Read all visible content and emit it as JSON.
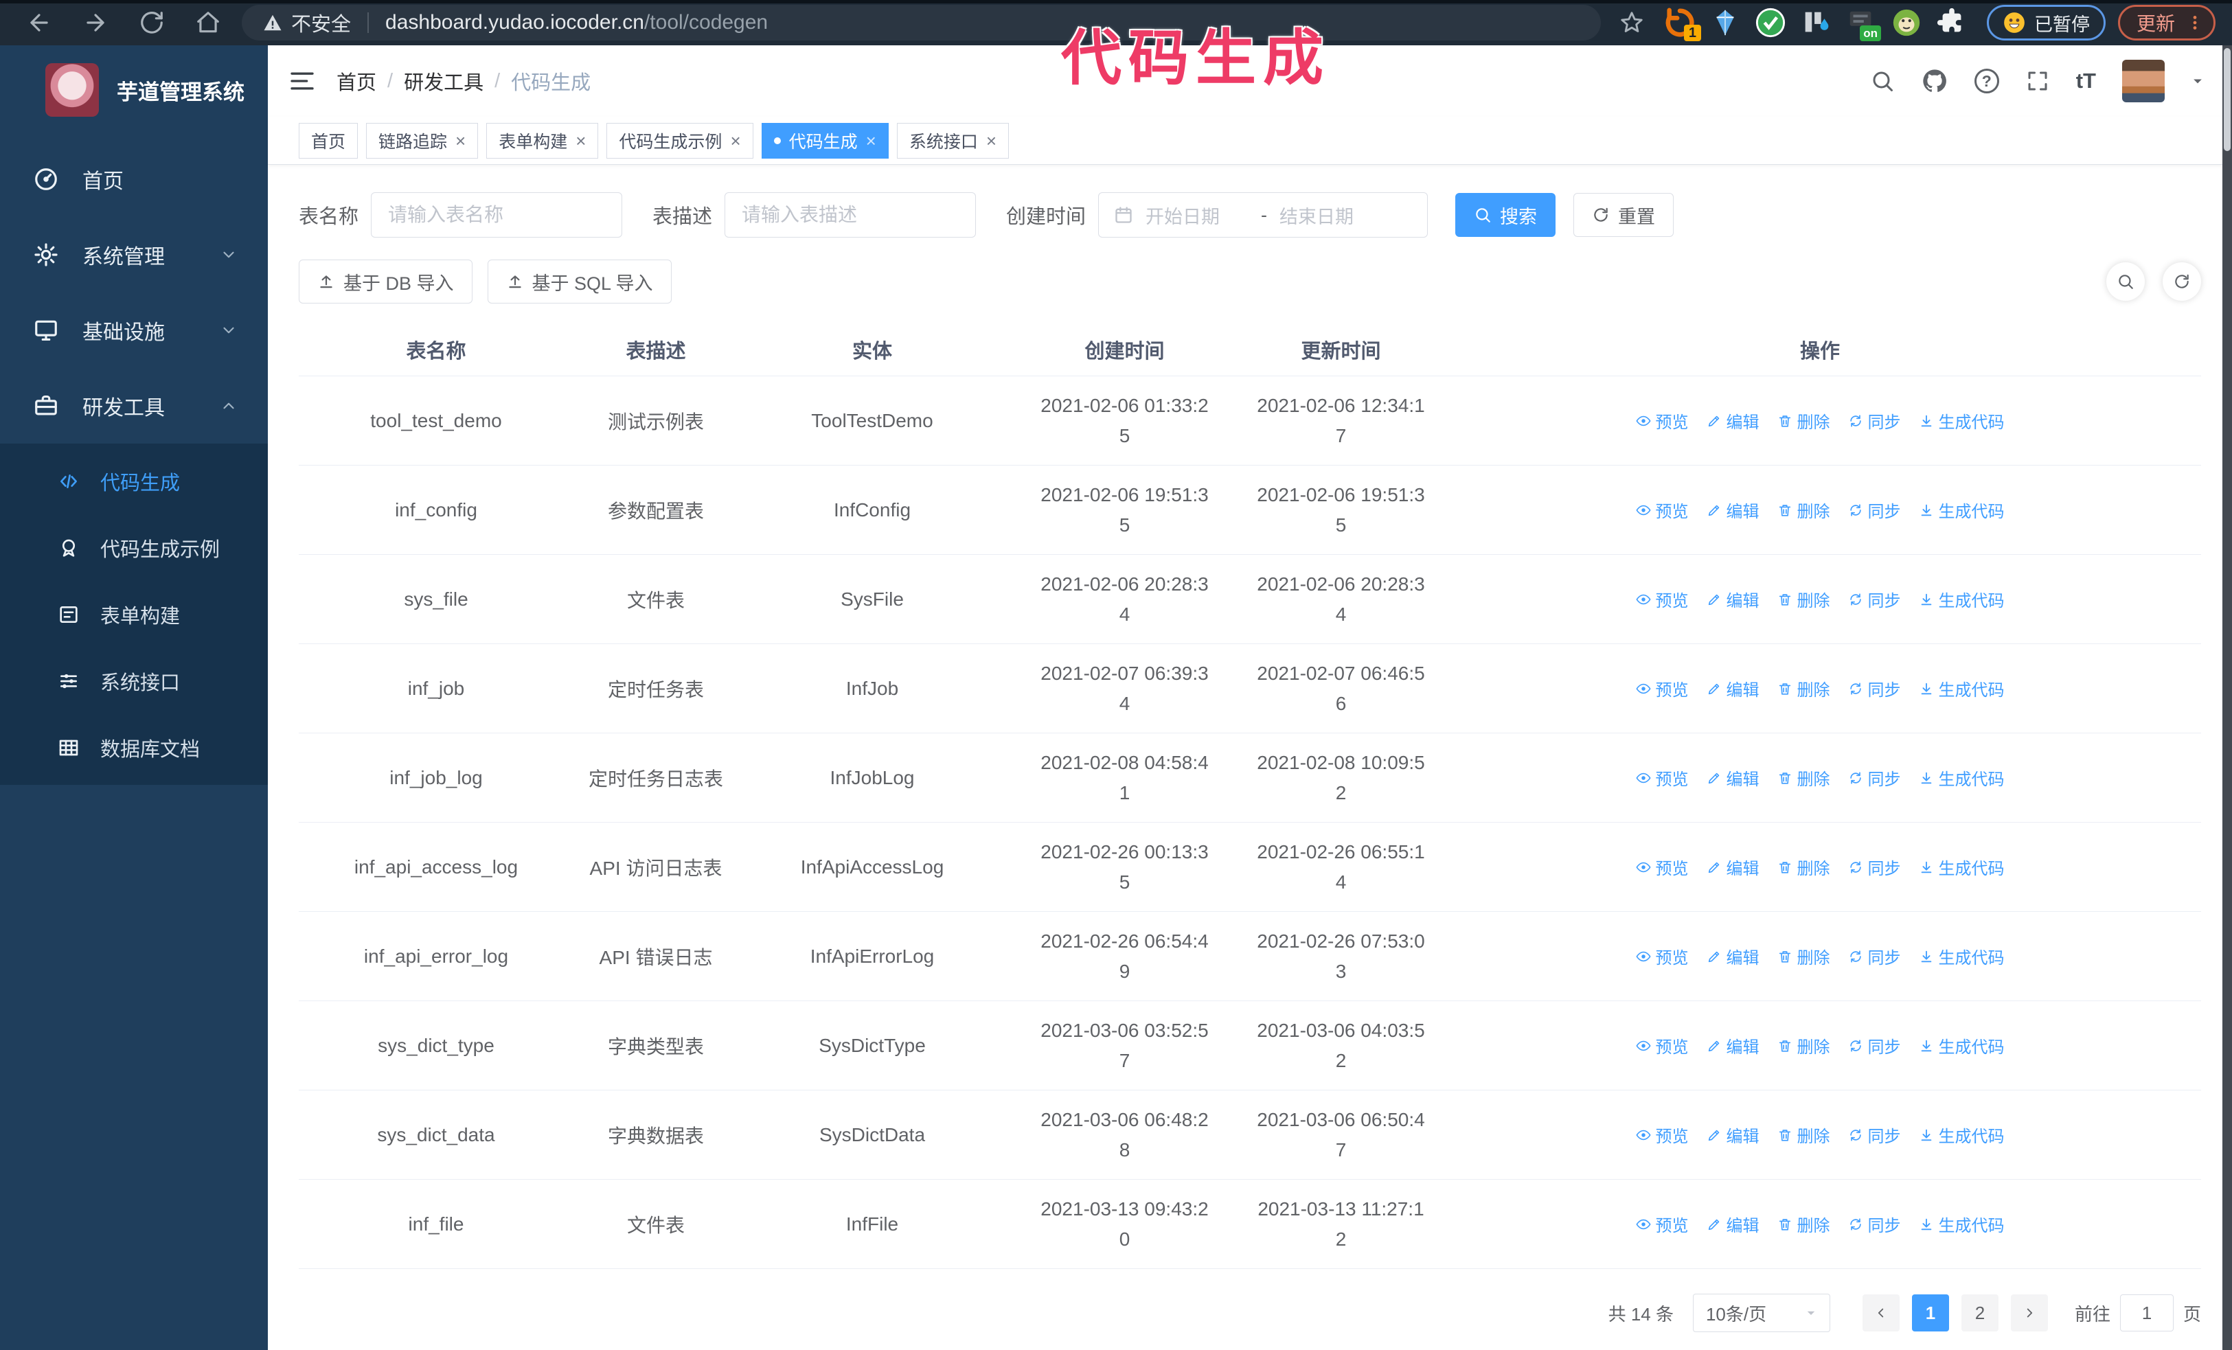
{
  "colors": {
    "accent": "#409eff",
    "annotation": "#ee3b66",
    "sidebar_bg": "#1f3e5c",
    "submenu_bg": "#16324c"
  },
  "overlay": {
    "title": "代码生成"
  },
  "browser": {
    "not_secure_label": "不安全",
    "url_host": "dashboard.yudao.iocoder.cn",
    "url_path": "/tool/codegen",
    "ext_badge": "1",
    "ext_on": "on",
    "paused_label": "已暂停",
    "update_label": "更新"
  },
  "sidebar": {
    "app_title": "芋道管理系统",
    "items": [
      {
        "id": "home",
        "label": "首页",
        "icon": "gauge-icon",
        "chevron": ""
      },
      {
        "id": "system",
        "label": "系统管理",
        "icon": "gear-icon",
        "chevron": "chevron-down-icon"
      },
      {
        "id": "infra",
        "label": "基础设施",
        "icon": "monitor-icon",
        "chevron": "chevron-down-icon"
      },
      {
        "id": "devtools",
        "label": "研发工具",
        "icon": "toolbox-icon",
        "chevron": "chevron-up-icon"
      }
    ],
    "subitems": [
      {
        "id": "codegen",
        "label": "代码生成",
        "icon": "code-icon",
        "active": true
      },
      {
        "id": "codegen-demo",
        "label": "代码生成示例",
        "icon": "medal-icon",
        "active": false
      },
      {
        "id": "form-builder",
        "label": "表单构建",
        "icon": "form-icon",
        "active": false
      },
      {
        "id": "system-api",
        "label": "系统接口",
        "icon": "sliders-icon",
        "active": false
      },
      {
        "id": "db-doc",
        "label": "数据库文档",
        "icon": "dbgrid-icon",
        "active": false
      }
    ]
  },
  "header": {
    "breadcrumb": [
      "首页",
      "研发工具",
      "代码生成"
    ]
  },
  "tabs": [
    {
      "id": "home",
      "label": "首页",
      "closable": false,
      "active": false
    },
    {
      "id": "tracing",
      "label": "链路追踪",
      "closable": true,
      "active": false
    },
    {
      "id": "form-builder",
      "label": "表单构建",
      "closable": true,
      "active": false
    },
    {
      "id": "codegen-demo",
      "label": "代码生成示例",
      "closable": true,
      "active": false
    },
    {
      "id": "codegen",
      "label": "代码生成",
      "closable": true,
      "active": true
    },
    {
      "id": "system-api",
      "label": "系统接口",
      "closable": true,
      "active": false
    }
  ],
  "filters": {
    "name_label": "表名称",
    "name_placeholder": "请输入表名称",
    "desc_label": "表描述",
    "desc_placeholder": "请输入表描述",
    "time_label": "创建时间",
    "start_placeholder": "开始日期",
    "range_separator": "-",
    "end_placeholder": "结束日期",
    "search_label": "搜索",
    "reset_label": "重置"
  },
  "toolbar": {
    "import_db_label": "基于 DB 导入",
    "import_sql_label": "基于 SQL 导入"
  },
  "table": {
    "columns": [
      "表名称",
      "表描述",
      "实体",
      "创建时间",
      "更新时间",
      "操作"
    ],
    "actions": [
      {
        "id": "preview",
        "label": "预览",
        "icon": "eye-icon"
      },
      {
        "id": "edit",
        "label": "编辑",
        "icon": "pen-icon"
      },
      {
        "id": "delete",
        "label": "删除",
        "icon": "trash-icon"
      },
      {
        "id": "sync",
        "label": "同步",
        "icon": "sync-icon"
      },
      {
        "id": "generate",
        "label": "生成代码",
        "icon": "download-icon"
      }
    ],
    "rows": [
      {
        "name": "tool_test_demo",
        "desc": "测试示例表",
        "entity": "ToolTestDemo",
        "created": "2021-02-06 01:33:25",
        "updated": "2021-02-06 12:34:17"
      },
      {
        "name": "inf_config",
        "desc": "参数配置表",
        "entity": "InfConfig",
        "created": "2021-02-06 19:51:35",
        "updated": "2021-02-06 19:51:35"
      },
      {
        "name": "sys_file",
        "desc": "文件表",
        "entity": "SysFile",
        "created": "2021-02-06 20:28:34",
        "updated": "2021-02-06 20:28:34"
      },
      {
        "name": "inf_job",
        "desc": "定时任务表",
        "entity": "InfJob",
        "created": "2021-02-07 06:39:34",
        "updated": "2021-02-07 06:46:56"
      },
      {
        "name": "inf_job_log",
        "desc": "定时任务日志表",
        "entity": "InfJobLog",
        "created": "2021-02-08 04:58:41",
        "updated": "2021-02-08 10:09:52"
      },
      {
        "name": "inf_api_access_log",
        "desc": "API 访问日志表",
        "entity": "InfApiAccessLog",
        "created": "2021-02-26 00:13:35",
        "updated": "2021-02-26 06:55:14"
      },
      {
        "name": "inf_api_error_log",
        "desc": "API 错误日志",
        "entity": "InfApiErrorLog",
        "created": "2021-02-26 06:54:49",
        "updated": "2021-02-26 07:53:03"
      },
      {
        "name": "sys_dict_type",
        "desc": "字典类型表",
        "entity": "SysDictType",
        "created": "2021-03-06 03:52:57",
        "updated": "2021-03-06 04:03:52"
      },
      {
        "name": "sys_dict_data",
        "desc": "字典数据表",
        "entity": "SysDictData",
        "created": "2021-03-06 06:48:28",
        "updated": "2021-03-06 06:50:47"
      },
      {
        "name": "inf_file",
        "desc": "文件表",
        "entity": "InfFile",
        "created": "2021-03-13 09:43:20",
        "updated": "2021-03-13 11:27:12"
      }
    ]
  },
  "pagination": {
    "total_label": "共 14 条",
    "size_label": "10条/页",
    "pages": [
      "1",
      "2"
    ],
    "current": "1",
    "goto_label": "前往",
    "goto_value": "1",
    "page_label": "页"
  }
}
